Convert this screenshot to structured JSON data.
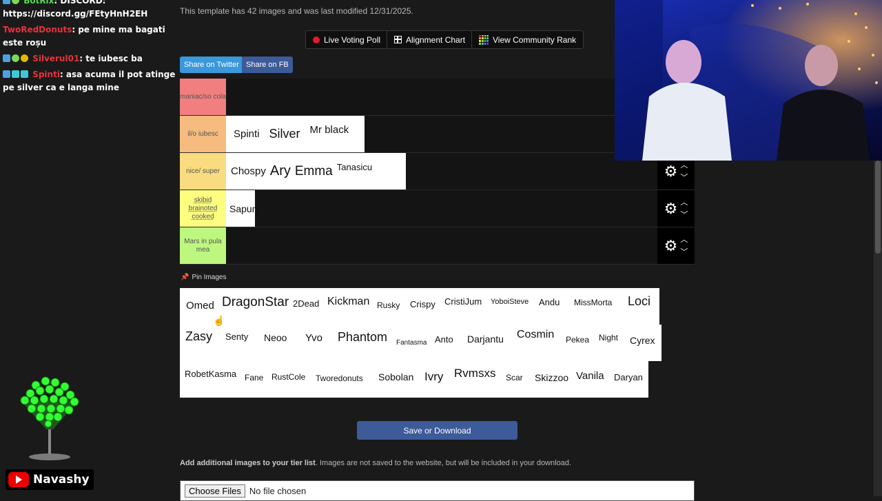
{
  "chat": [
    {
      "user": "BotRix",
      "msg": ": DISCORD:",
      "user_class": "u-green",
      "badges": [
        "b-blue",
        "b-green"
      ]
    },
    {
      "user": "",
      "msg": "https://discord.gg/FEtyHnH2EH",
      "user_class": "",
      "badges": []
    },
    {
      "user": "TwoRedDonuts",
      "msg": ": pe mine ma bagati este roșu",
      "user_class": "u-red",
      "badges": []
    },
    {
      "user": "Silverul01",
      "msg": ": te iubesc ba",
      "user_class": "u-red",
      "badges": [
        "b-blue",
        "b-green",
        "b-gold"
      ]
    },
    {
      "user": "Spinti",
      "msg": ": asa acuma il pot atinge pe silver ca e langa mine",
      "user_class": "u-red",
      "badges": [
        "b-blue",
        "b-cyan",
        "b-cyan"
      ]
    }
  ],
  "meta_text": "This template has 42 images and was last modified 12/31/2025.",
  "buttons": {
    "live_voting": "Live Voting Poll",
    "alignment": "Alignment Chart",
    "community_rank": "View Community Rank",
    "share_twitter": "Share on Twitter",
    "share_fb": "Share on FB"
  },
  "colors": {
    "twitter": "#3a98db",
    "fb": "#3d5a99",
    "tier_s": "#f27f7f",
    "tier_a": "#f6bb7e",
    "tier_b": "#f9dc7f",
    "tier_c": "#fdfd80",
    "tier_d": "#bef77f"
  },
  "tiers": [
    {
      "label": "maniac/so cola",
      "items": []
    },
    {
      "label": "il/o iubesc",
      "items": [
        "Spinti",
        "Silver",
        "Mr black"
      ]
    },
    {
      "label": "nice/ super",
      "items": [
        "Chospy",
        "Ary",
        "Emma",
        "Tanasicu"
      ]
    },
    {
      "label": "skibid brainoted cooked",
      "items": [
        "Sapun"
      ]
    },
    {
      "label": "Mars in pula mea",
      "items": []
    }
  ],
  "pin_label": "Pin Images",
  "pool": [
    [
      "Omed",
      "DragonStar",
      "2Dead",
      "Kickman",
      "Rusky",
      "Crispy",
      "CristiJum",
      "YoboiSteve",
      "Andu",
      "MissMorta",
      "Loci"
    ],
    [
      "Zasy",
      "Senty",
      "Neoo",
      "Yvo",
      "Phantom",
      "Fantasma",
      "Anto",
      "Darjantu",
      "Cosmin",
      "Pekea",
      "Night",
      "Cyrex"
    ],
    [
      "RobetKasma",
      "Fane",
      "RustCole",
      "Tworedonuts",
      "Sobolan",
      "Ivry",
      "Rvmsxs",
      "Scar",
      "Skizzoo",
      "Vanila",
      "Daryan"
    ]
  ],
  "save_label": "Save or Download",
  "add_bold": "Add additional images to your tier list",
  "add_rest": ". Images are not saved to the website, but will be included in your download.",
  "file_button": "Choose Files",
  "file_status": "No file chosen",
  "streamer": "Navashy"
}
